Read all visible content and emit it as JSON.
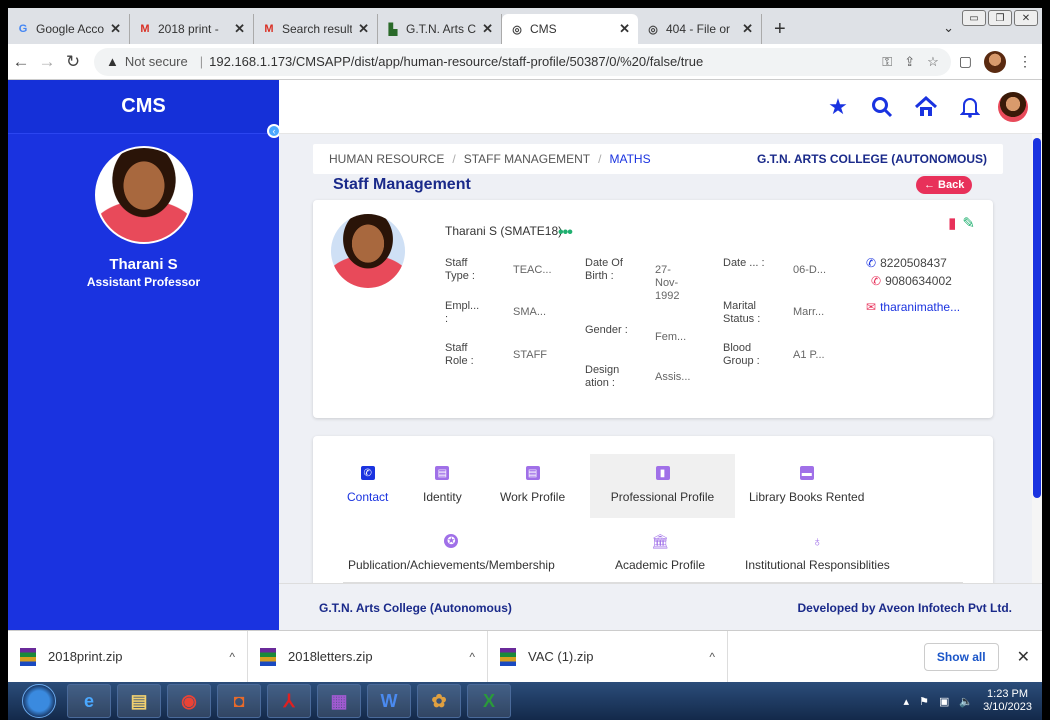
{
  "browser": {
    "tabs": [
      {
        "label": "Google Acco",
        "icon": "google-icon",
        "active": false
      },
      {
        "label": "2018 print -",
        "icon": "gmail-icon",
        "active": false
      },
      {
        "label": "Search result",
        "icon": "gmail-icon",
        "active": false
      },
      {
        "label": "G.T.N. Arts C",
        "icon": "college-icon",
        "active": false
      },
      {
        "label": "CMS",
        "icon": "globe-icon",
        "active": true
      },
      {
        "label": "404 - File or",
        "icon": "globe-icon",
        "active": false
      }
    ],
    "not_secure": "Not secure",
    "url": "192.168.1.173/CMSAPP/dist/app/human-resource/staff-profile/50387/0/%20/false/true"
  },
  "sidebar": {
    "brand": "CMS",
    "name": "Tharani S",
    "role": "Assistant Professor"
  },
  "breadcrumb": {
    "items": [
      "HUMAN RESOURCE",
      "STAFF MANAGEMENT",
      "MATHS"
    ],
    "college": "G.T.N. ARTS COLLEGE (AUTONOMOUS)"
  },
  "page": {
    "title": "Staff Management",
    "back": "← Back"
  },
  "profile": {
    "name": "Tharani S (SMATE18)",
    "fields": {
      "staff_type_label": "Staff Type :",
      "staff_type": "TEAC...",
      "empl_label": "Empl... :",
      "empl": "SMA...",
      "staff_role_label": "Staff Role :",
      "staff_role": "STAFF",
      "dob_label": "Date Of Birth :",
      "dob": "27-Nov-1992",
      "gender_label": "Gender :",
      "gender": "Fem...",
      "designation_label": "Design ation :",
      "designation": "Assis...",
      "date_label": "Date ... :",
      "date": "06-D...",
      "marital_label": "Marital Status :",
      "marital": "Marr...",
      "blood_label": "Blood Group :",
      "blood": "A1 P..."
    },
    "phone1": "8220508437",
    "phone2": "9080634002",
    "email": "tharanimathe..."
  },
  "tabs": [
    {
      "label": "Contact",
      "icon": "contact-icon",
      "color": "#1a33e0"
    },
    {
      "label": "Identity",
      "icon": "id-card-icon",
      "color": "#a070e8"
    },
    {
      "label": "Work Profile",
      "icon": "id-card-icon",
      "color": "#a070e8"
    },
    {
      "label": "Professional Profile",
      "icon": "document-icon",
      "color": "#a070e8"
    },
    {
      "label": "Library Books Rented",
      "icon": "book-icon",
      "color": "#a070e8"
    },
    {
      "label": "Publication/Achievements/Membership",
      "icon": "medal-icon",
      "color": "#a070e8"
    },
    {
      "label": "Academic Profile",
      "icon": "institution-icon",
      "color": "#a070e8"
    },
    {
      "label": "Institutional Responsiblities",
      "icon": "award-icon",
      "color": "#a070e8"
    }
  ],
  "footer": {
    "left": "G.T.N. Arts College (Autonomous)",
    "right": "Developed by Aveon Infotech Pvt Ltd."
  },
  "downloads": {
    "items": [
      "2018print.zip",
      "2018letters.zip",
      "VAC (1).zip"
    ],
    "show_all": "Show all"
  },
  "clock": {
    "time": "1:23 PM",
    "date": "3/10/2023"
  }
}
